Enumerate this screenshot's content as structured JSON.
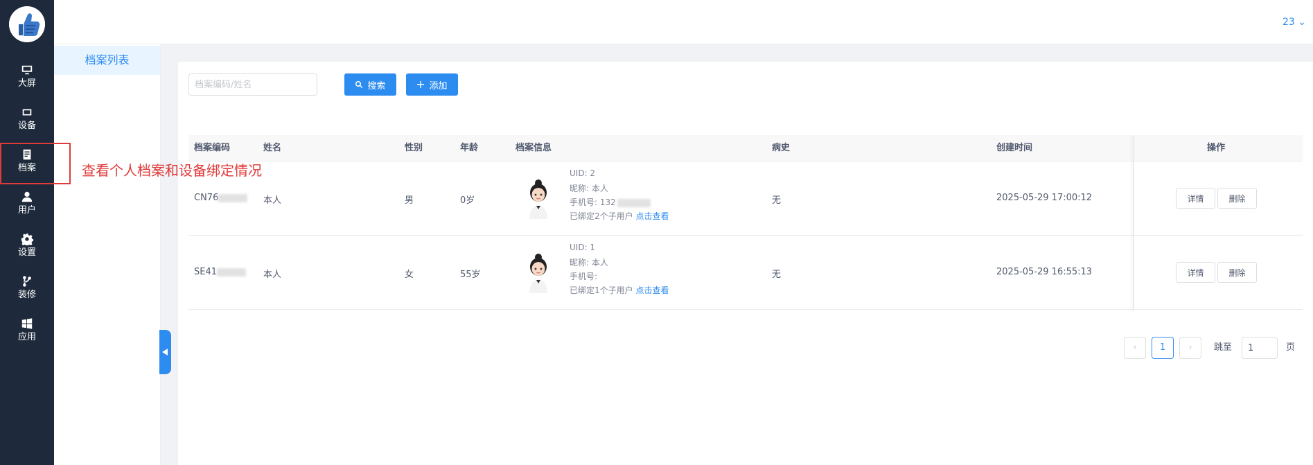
{
  "sidebar": {
    "items": [
      {
        "label": "大屏",
        "icon": "monitor-icon"
      },
      {
        "label": "设备",
        "icon": "device-icon"
      },
      {
        "label": "档案",
        "icon": "document-icon"
      },
      {
        "label": "用户",
        "icon": "user-icon"
      },
      {
        "label": "设置",
        "icon": "gear-icon"
      },
      {
        "label": "装修",
        "icon": "decorate-icon"
      },
      {
        "label": "应用",
        "icon": "windows-icon"
      }
    ],
    "active": "档案"
  },
  "annotation": "查看个人档案和设备绑定情况",
  "header": {
    "user": "23"
  },
  "submenu": {
    "items": [
      {
        "label": "档案列表"
      }
    ]
  },
  "search": {
    "placeholder": "档案编码/姓名",
    "search_label": "搜索",
    "add_label": "添加"
  },
  "table": {
    "columns": [
      "档案编码",
      "姓名",
      "性别",
      "年龄",
      "档案信息",
      "病史",
      "创建时间",
      "操作"
    ],
    "rows": [
      {
        "code": "CN76",
        "name": "本人",
        "gender": "男",
        "age": "0岁",
        "uid": "UID: 2",
        "nickname": "昵称: 本人",
        "phone": "手机号: 132",
        "bound_text": "已绑定2个子用户",
        "bound_link": "点击查看",
        "history": "无",
        "created": "2025-05-29 17:00:12",
        "actions": [
          "详情",
          "删除"
        ]
      },
      {
        "code": "SE41",
        "name": "本人",
        "gender": "女",
        "age": "55岁",
        "uid": "UID: 1",
        "nickname": "昵称: 本人",
        "phone": "手机号:",
        "bound_text": "已绑定1个子用户",
        "bound_link": "点击查看",
        "history": "无",
        "created": "2025-05-29 16:55:13",
        "actions": [
          "详情",
          "删除"
        ]
      }
    ]
  },
  "pagination": {
    "prev": "‹",
    "current": "1",
    "next": "›",
    "jump_label": "跳至",
    "jump_value": "1",
    "page_suffix": "页"
  },
  "colors": {
    "sidebar": "#1e2a3b",
    "accent": "#2d8cf0",
    "highlight": "#e03a3a"
  }
}
